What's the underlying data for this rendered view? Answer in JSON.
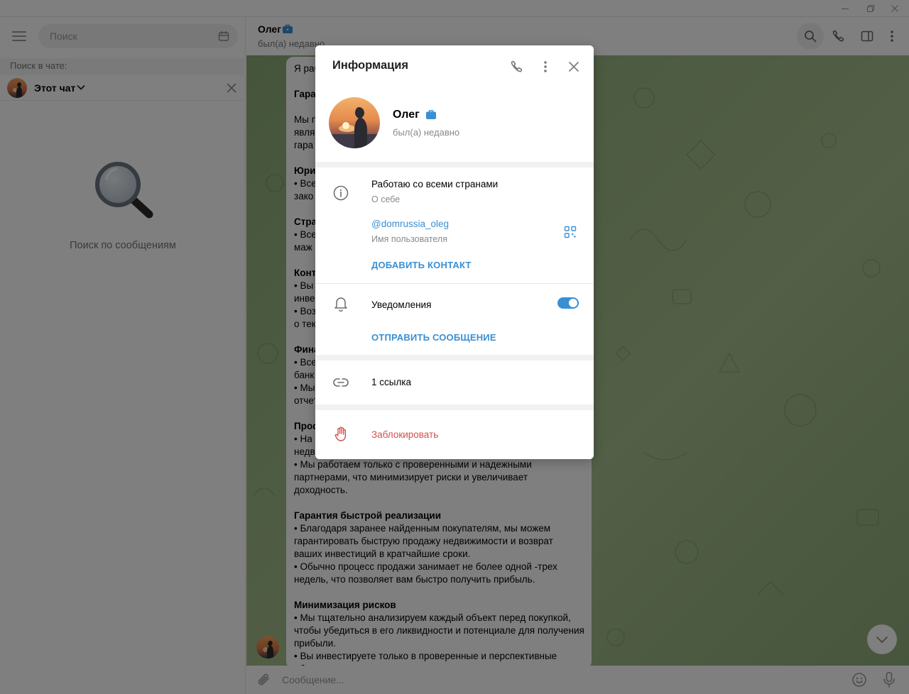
{
  "colors": {
    "accent": "#3a8fd3",
    "danger": "#d14e4e",
    "verified_badge": "#3a8fd3"
  },
  "sidebar": {
    "search_placeholder": "Поиск",
    "search_in_chat_label": "Поиск в чате:",
    "filter_label": "Этот чат",
    "empty_text": "Поиск по сообщениям"
  },
  "chat": {
    "peer_name": "Олег",
    "peer_status": "был(а) недавно",
    "composer_placeholder": "Сообщение...",
    "message_lines": [
      {
        "text": "Я раб",
        "heading": false
      },
      {
        "text": "",
        "heading": false
      },
      {
        "text": "Гара",
        "heading": true
      },
      {
        "text": "",
        "heading": false
      },
      {
        "text": "Мы п",
        "heading": false
      },
      {
        "text": "явля",
        "heading": false
      },
      {
        "text": "гара",
        "heading": false
      },
      {
        "text": "",
        "heading": false
      },
      {
        "text": "Юри",
        "heading": true
      },
      {
        "text": " • Все",
        "heading": false
      },
      {
        "text": "зако",
        "heading": false
      },
      {
        "text": "",
        "heading": false
      },
      {
        "text": "Стра",
        "heading": true
      },
      {
        "text": " • Все",
        "heading": false
      },
      {
        "text": "маж",
        "heading": false
      },
      {
        "text": "",
        "heading": false
      },
      {
        "text": "Конт",
        "heading": true
      },
      {
        "text": " • Вы",
        "heading": false
      },
      {
        "text": "инве",
        "heading": false
      },
      {
        "text": " • Воз",
        "heading": false
      },
      {
        "text": "о тек",
        "heading": false
      },
      {
        "text": "",
        "heading": false
      },
      {
        "text": "Фина",
        "heading": true
      },
      {
        "text": " • Все",
        "heading": false
      },
      {
        "text": "банк",
        "heading": false
      },
      {
        "text": " • Мы",
        "heading": false
      },
      {
        "text": "отчет",
        "heading": false
      },
      {
        "text": "",
        "heading": false
      },
      {
        "text": "Проф",
        "heading": true
      },
      {
        "text": " • На",
        "heading": false
      },
      {
        "text": "недв",
        "heading": false
      },
      {
        "text": " • Мы работаем только с проверенными и надежными",
        "heading": false
      },
      {
        "text": "партнерами, что минимизирует риски и увеличивает",
        "heading": false
      },
      {
        "text": "доходность.",
        "heading": false
      },
      {
        "text": "",
        "heading": false
      },
      {
        "text": "Гарантия быстрой реализации",
        "heading": true
      },
      {
        "text": " • Благодаря заранее найденным покупателям, мы можем",
        "heading": false
      },
      {
        "text": "гарантировать быструю продажу недвижимости и возврат",
        "heading": false
      },
      {
        "text": "ваших инвестиций в кратчайшие сроки.",
        "heading": false
      },
      {
        "text": " • Обычно процесс продажи занимает не более одной -трех",
        "heading": false
      },
      {
        "text": "недель, что позволяет вам быстро получить прибыль.",
        "heading": false
      },
      {
        "text": "",
        "heading": false
      },
      {
        "text": "Минимизация рисков",
        "heading": true
      },
      {
        "text": " • Мы тщательно анализируем каждый объект перед покупкой,",
        "heading": false
      },
      {
        "text": "чтобы убедиться в его ликвидности и потенциале для получения",
        "heading": false
      },
      {
        "text": "прибыли.",
        "heading": false
      },
      {
        "text": " • Вы инвестируете только в проверенные и перспективные",
        "heading": false
      },
      {
        "text": "объекты недвижимости",
        "heading": false
      }
    ]
  },
  "modal": {
    "title": "Информация",
    "name": "Олег",
    "status": "был(а) недавно",
    "bio": "Работаю со всеми странами",
    "bio_label": "О себе",
    "username": "@domrussia_oleg",
    "username_label": "Имя пользователя",
    "add_contact": "ДОБАВИТЬ КОНТАКТ",
    "notifications_label": "Уведомления",
    "notifications_on": true,
    "send_message": "ОТПРАВИТЬ СООБЩЕНИЕ",
    "links": "1 ссылка",
    "block": "Заблокировать"
  },
  "icons": {
    "menu": "hamburger-icon",
    "calendar": "calendar-icon",
    "search": "search-icon",
    "phone": "phone-icon",
    "sidebar_toggle": "sidebar-toggle-icon",
    "more": "more-vertical-icon",
    "close": "close-icon",
    "info": "info-icon",
    "qr": "qr-code-icon",
    "bell": "bell-icon",
    "link": "link-icon",
    "hand": "hand-stop-icon",
    "attach": "paperclip-icon",
    "emoji": "emoji-icon",
    "mic": "microphone-icon",
    "chevron_down": "chevron-down-icon"
  }
}
